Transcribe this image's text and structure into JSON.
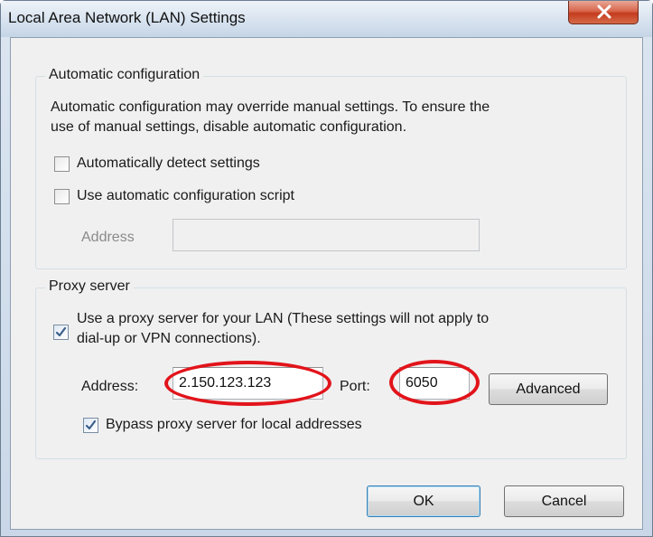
{
  "window": {
    "title": "Local Area Network (LAN) Settings"
  },
  "auto_config": {
    "legend": "Automatic configuration",
    "desc_line1": "Automatic configuration may override manual settings.  To ensure the",
    "desc_line2": "use of manual settings, disable automatic configuration.",
    "detect_label": "Automatically detect settings",
    "detect_checked": false,
    "script_label": "Use automatic configuration script",
    "script_checked": false,
    "address_label": "Address",
    "address_value": ""
  },
  "proxy": {
    "legend": "Proxy server",
    "use_proxy_line1": "Use a proxy server for your LAN (These settings will not apply to",
    "use_proxy_line2": "dial-up or VPN connections).",
    "use_proxy_checked": true,
    "address_label": "Address:",
    "address_value": "2.150.123.123",
    "port_label": "Port:",
    "port_value": "6050",
    "advanced_label": "Advanced",
    "bypass_label": "Bypass proxy server for local addresses",
    "bypass_checked": true
  },
  "buttons": {
    "ok_label": "OK",
    "cancel_label": "Cancel"
  },
  "colors": {
    "highlight": "#e2141b",
    "title_bar": "#d5e1ee",
    "close_button": "#c43c1e"
  }
}
